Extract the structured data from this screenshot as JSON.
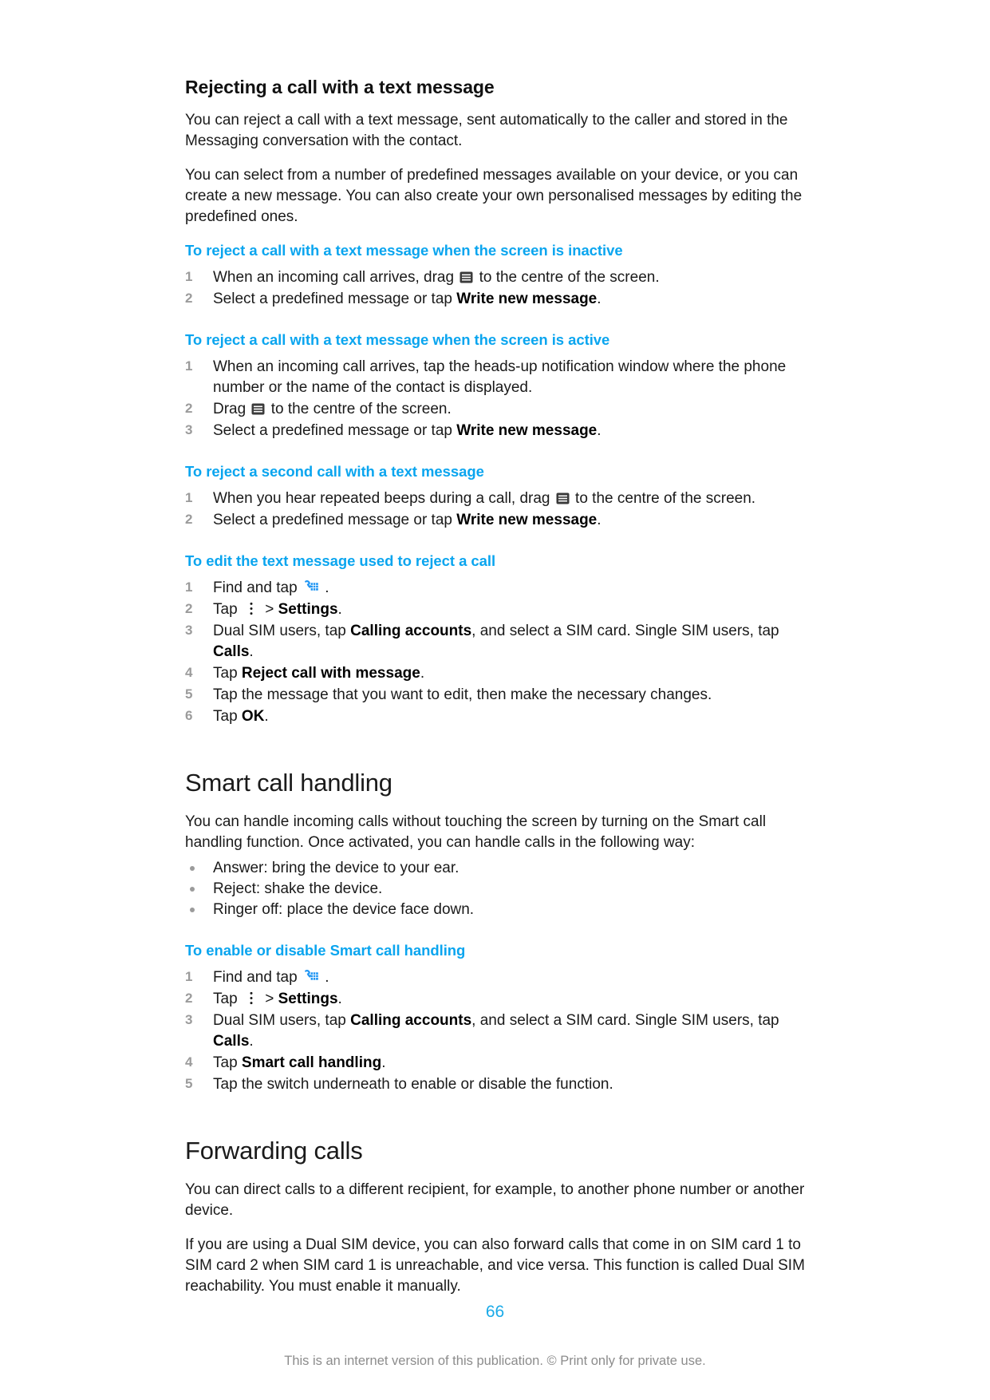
{
  "document": {
    "page_number": "66",
    "footer_note": "This is an internet version of this publication. © Print only for private use.",
    "accent_color": "#0aa5ef",
    "page_number_color": "#1aaae8"
  },
  "topic1": {
    "title": "Rejecting a call with a text message",
    "intro1": "You can reject a call with a text message, sent automatically to the caller and stored in the Messaging conversation with the contact.",
    "intro2": "You can select from a number of predefined messages available on your device, or you can create a new message. You can also create your own personalised messages by editing the predefined ones.",
    "proc1": {
      "title": "To reject a call with a text message when the screen is inactive",
      "steps": [
        {
          "num": "1",
          "pre": "When an incoming call arrives, drag ",
          "icon": "message-icon",
          "post": " to the centre of the screen."
        },
        {
          "num": "2",
          "pre": "Select a predefined message or tap ",
          "bold": "Write new message",
          "post": "."
        }
      ]
    },
    "proc2": {
      "title": "To reject a call with a text message when the screen is active",
      "steps": [
        {
          "num": "1",
          "pre": "When an incoming call arrives, tap the heads-up notification window where the phone number or the name of the contact is displayed."
        },
        {
          "num": "2",
          "pre": "Drag ",
          "icon": "message-icon",
          "post": " to the centre of the screen."
        },
        {
          "num": "3",
          "pre": "Select a predefined message or tap ",
          "bold": "Write new message",
          "post": "."
        }
      ]
    },
    "proc3": {
      "title": "To reject a second call with a text message",
      "steps": [
        {
          "num": "1",
          "pre": "When you hear repeated beeps during a call, drag ",
          "icon": "message-icon",
          "post": " to the centre of the screen."
        },
        {
          "num": "2",
          "pre": "Select a predefined message or tap ",
          "bold": "Write new message",
          "post": "."
        }
      ]
    },
    "proc4": {
      "title": "To edit the text message used to reject a call",
      "steps": [
        {
          "num": "1",
          "pre": "Find and tap ",
          "icon": "dialer-icon",
          "post": " ."
        },
        {
          "num": "2",
          "pre": "Tap ",
          "icon": "overflow-menu-icon",
          "mid": " > ",
          "bold": "Settings",
          "post": "."
        },
        {
          "num": "3",
          "pre": "Dual SIM users, tap ",
          "bold": "Calling accounts",
          "mid2": ", and select a SIM card. Single SIM users, tap ",
          "bold2": "Calls",
          "post": "."
        },
        {
          "num": "4",
          "pre": "Tap ",
          "bold": "Reject call with message",
          "post": "."
        },
        {
          "num": "5",
          "pre": "Tap the message that you want to edit, then make the necessary changes."
        },
        {
          "num": "6",
          "pre": "Tap ",
          "bold": "OK",
          "post": "."
        }
      ]
    }
  },
  "topic2": {
    "title": "Smart call handling",
    "intro": "You can handle incoming calls without touching the screen by turning on the Smart call handling function. Once activated, you can handle calls in the following way:",
    "bullets": [
      "Answer: bring the device to your ear.",
      "Reject: shake the device.",
      "Ringer off: place the device face down."
    ],
    "proc1": {
      "title": "To enable or disable Smart call handling",
      "steps": [
        {
          "num": "1",
          "pre": "Find and tap ",
          "icon": "dialer-icon",
          "post": " ."
        },
        {
          "num": "2",
          "pre": "Tap ",
          "icon": "overflow-menu-icon",
          "mid": " > ",
          "bold": "Settings",
          "post": "."
        },
        {
          "num": "3",
          "pre": "Dual SIM users, tap ",
          "bold": "Calling accounts",
          "mid2": ", and select a SIM card. Single SIM users, tap ",
          "bold2": "Calls",
          "post": "."
        },
        {
          "num": "4",
          "pre": "Tap ",
          "bold": "Smart call handling",
          "post": "."
        },
        {
          "num": "5",
          "pre": "Tap the switch underneath to enable or disable the function."
        }
      ]
    }
  },
  "topic3": {
    "title": "Forwarding calls",
    "intro1": "You can direct calls to a different recipient, for example, to another phone number or another device.",
    "intro2": "If you are using a Dual SIM device, you can also forward calls that come in on SIM card 1 to SIM card 2 when SIM card 1 is unreachable, and vice versa. This function is called Dual SIM reachability. You must enable it manually."
  }
}
